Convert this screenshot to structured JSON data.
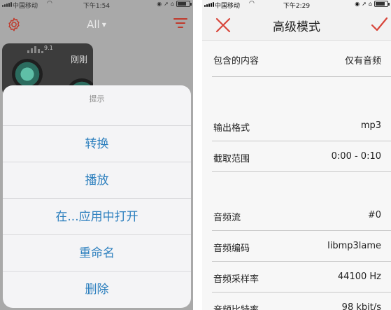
{
  "left": {
    "status": {
      "carrier": "中国移动",
      "time": "下午1:54"
    },
    "nav": {
      "title": "All"
    },
    "thumb": {
      "number": "9.1",
      "label": "刚刚"
    },
    "sheet": {
      "title": "提示",
      "items": [
        "转换",
        "播放",
        "在...应用中打开",
        "重命名",
        "删除"
      ]
    }
  },
  "right": {
    "status": {
      "carrier": "中国移动",
      "time": "下午2:29"
    },
    "nav": {
      "title": "高级模式"
    },
    "rows": [
      {
        "label": "包含的内容",
        "value": "仅有音频"
      },
      {
        "label": "输出格式",
        "value": "mp3"
      },
      {
        "label": "截取范围",
        "value": "0:00 - 0:10"
      },
      {
        "label": "音频流",
        "value": "#0"
      },
      {
        "label": "音频编码",
        "value": "libmp3lame"
      },
      {
        "label": "音频采样率",
        "value": "44100 Hz"
      },
      {
        "label": "音频比特率",
        "value": "98 kbit/s"
      }
    ]
  },
  "colors": {
    "accent": "#d8453a",
    "link": "#2c7fbe"
  },
  "icons": [
    "signal-icon",
    "wifi-icon",
    "alarm-icon",
    "location-icon",
    "headphones-icon",
    "battery-icon",
    "gear-icon",
    "chevron-down-icon",
    "filter-icon",
    "close-icon",
    "checkmark-icon"
  ]
}
